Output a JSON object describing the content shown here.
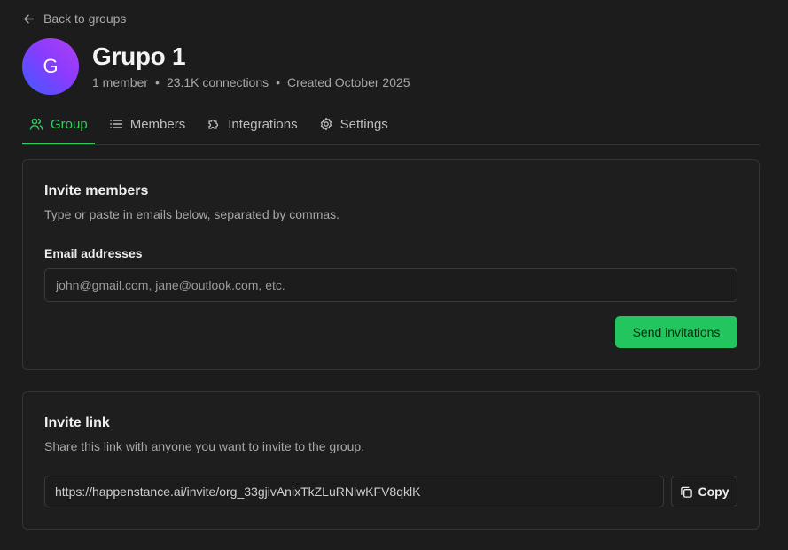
{
  "nav": {
    "back_label": "Back to groups"
  },
  "group": {
    "avatar_letter": "G",
    "name": "Grupo 1",
    "meta": [
      "1 member",
      "23.1K connections",
      "Created October 2025"
    ],
    "separator": "•"
  },
  "tabs": [
    {
      "label": "Group",
      "icon": "users-icon",
      "active": true
    },
    {
      "label": "Members",
      "icon": "list-icon",
      "active": false
    },
    {
      "label": "Integrations",
      "icon": "puzzle-icon",
      "active": false
    },
    {
      "label": "Settings",
      "icon": "gear-icon",
      "active": false
    }
  ],
  "invite_members": {
    "title": "Invite members",
    "description": "Type or paste in emails below, separated by commas.",
    "field_label": "Email addresses",
    "placeholder": "john@gmail.com, jane@outlook.com, etc.",
    "value": "",
    "submit_label": "Send invitations"
  },
  "invite_link": {
    "title": "Invite link",
    "description": "Share this link with anyone you want to invite to the group.",
    "url": "https://happenstance.ai/invite/org_33gjivAnixTkZLuRNlwKFV8qklK",
    "copy_label": "Copy"
  },
  "colors": {
    "accent": "#22c55e",
    "active_tab": "#2fcf63",
    "background": "#1c1c1c",
    "border": "#343434"
  }
}
